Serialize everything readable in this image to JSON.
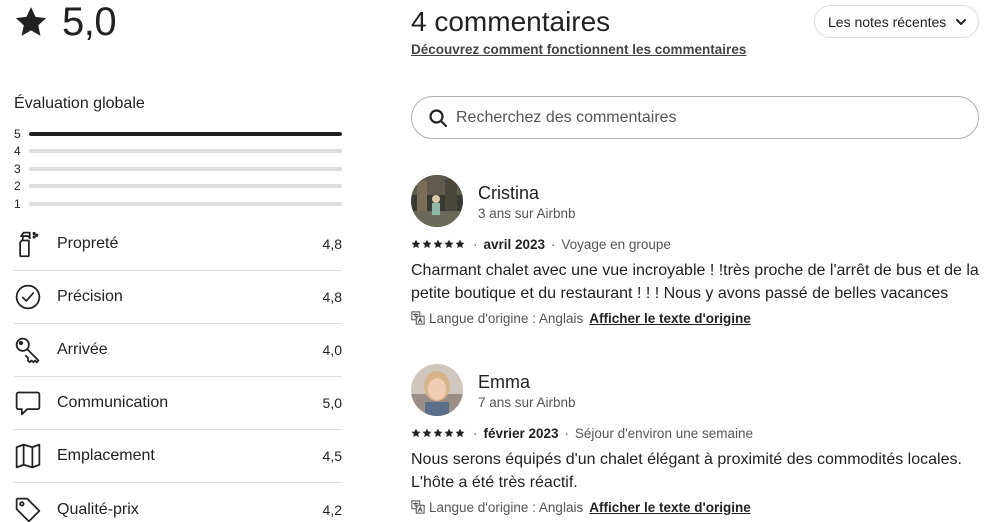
{
  "overall": {
    "score": "5,0",
    "icon": "star-icon"
  },
  "evaluation": {
    "title": "Évaluation globale",
    "distribution": [
      {
        "label": "5",
        "fraction": 1.0
      },
      {
        "label": "4",
        "fraction": 0.0
      },
      {
        "label": "3",
        "fraction": 0.0
      },
      {
        "label": "2",
        "fraction": 0.0
      },
      {
        "label": "1",
        "fraction": 0.0
      }
    ]
  },
  "categories": [
    {
      "label": "Propreté",
      "value": "4,8",
      "icon": "spray-bottle-icon"
    },
    {
      "label": "Précision",
      "value": "4,8",
      "icon": "check-circle-icon"
    },
    {
      "label": "Arrivée",
      "value": "4,0",
      "icon": "key-icon"
    },
    {
      "label": "Communication",
      "value": "5,0",
      "icon": "chat-bubble-icon"
    },
    {
      "label": "Emplacement",
      "value": "4,5",
      "icon": "map-icon"
    },
    {
      "label": "Qualité-prix",
      "value": "4,2",
      "icon": "price-tag-icon"
    }
  ],
  "reviews_header": {
    "title": "4 commentaires",
    "learn_link": "Découvrez comment fonctionnent les commentaires",
    "sort_label": "Les notes récentes"
  },
  "search": {
    "placeholder": "Recherchez des commentaires"
  },
  "reviews": [
    {
      "name": "Cristina",
      "since": "3 ans sur Airbnb",
      "rating": 5,
      "date": "avril 2023",
      "trip_type": "Voyage en groupe",
      "text": "Charmant chalet avec une vue incroyable ! !très proche de l'arrêt de bus et de la petite boutique et du restaurant ! ! ! Nous y avons passé de belles vacances",
      "language_note": "Langue d'origine : Anglais",
      "original_link": "Afficher le texte d'origine"
    },
    {
      "name": "Emma",
      "since": "7 ans sur Airbnb",
      "rating": 5,
      "date": "février 2023",
      "trip_type": "Séjour d'environ une semaine",
      "text": "Nous serons équipés d'un chalet élégant à proximité des commodités locales. L'hôte a été très réactif.",
      "language_note": "Langue d'origine : Anglais",
      "original_link": "Afficher le texte d'origine"
    }
  ],
  "colors": {
    "text": "#222222",
    "muted": "#555555",
    "divider": "#dddddd"
  }
}
